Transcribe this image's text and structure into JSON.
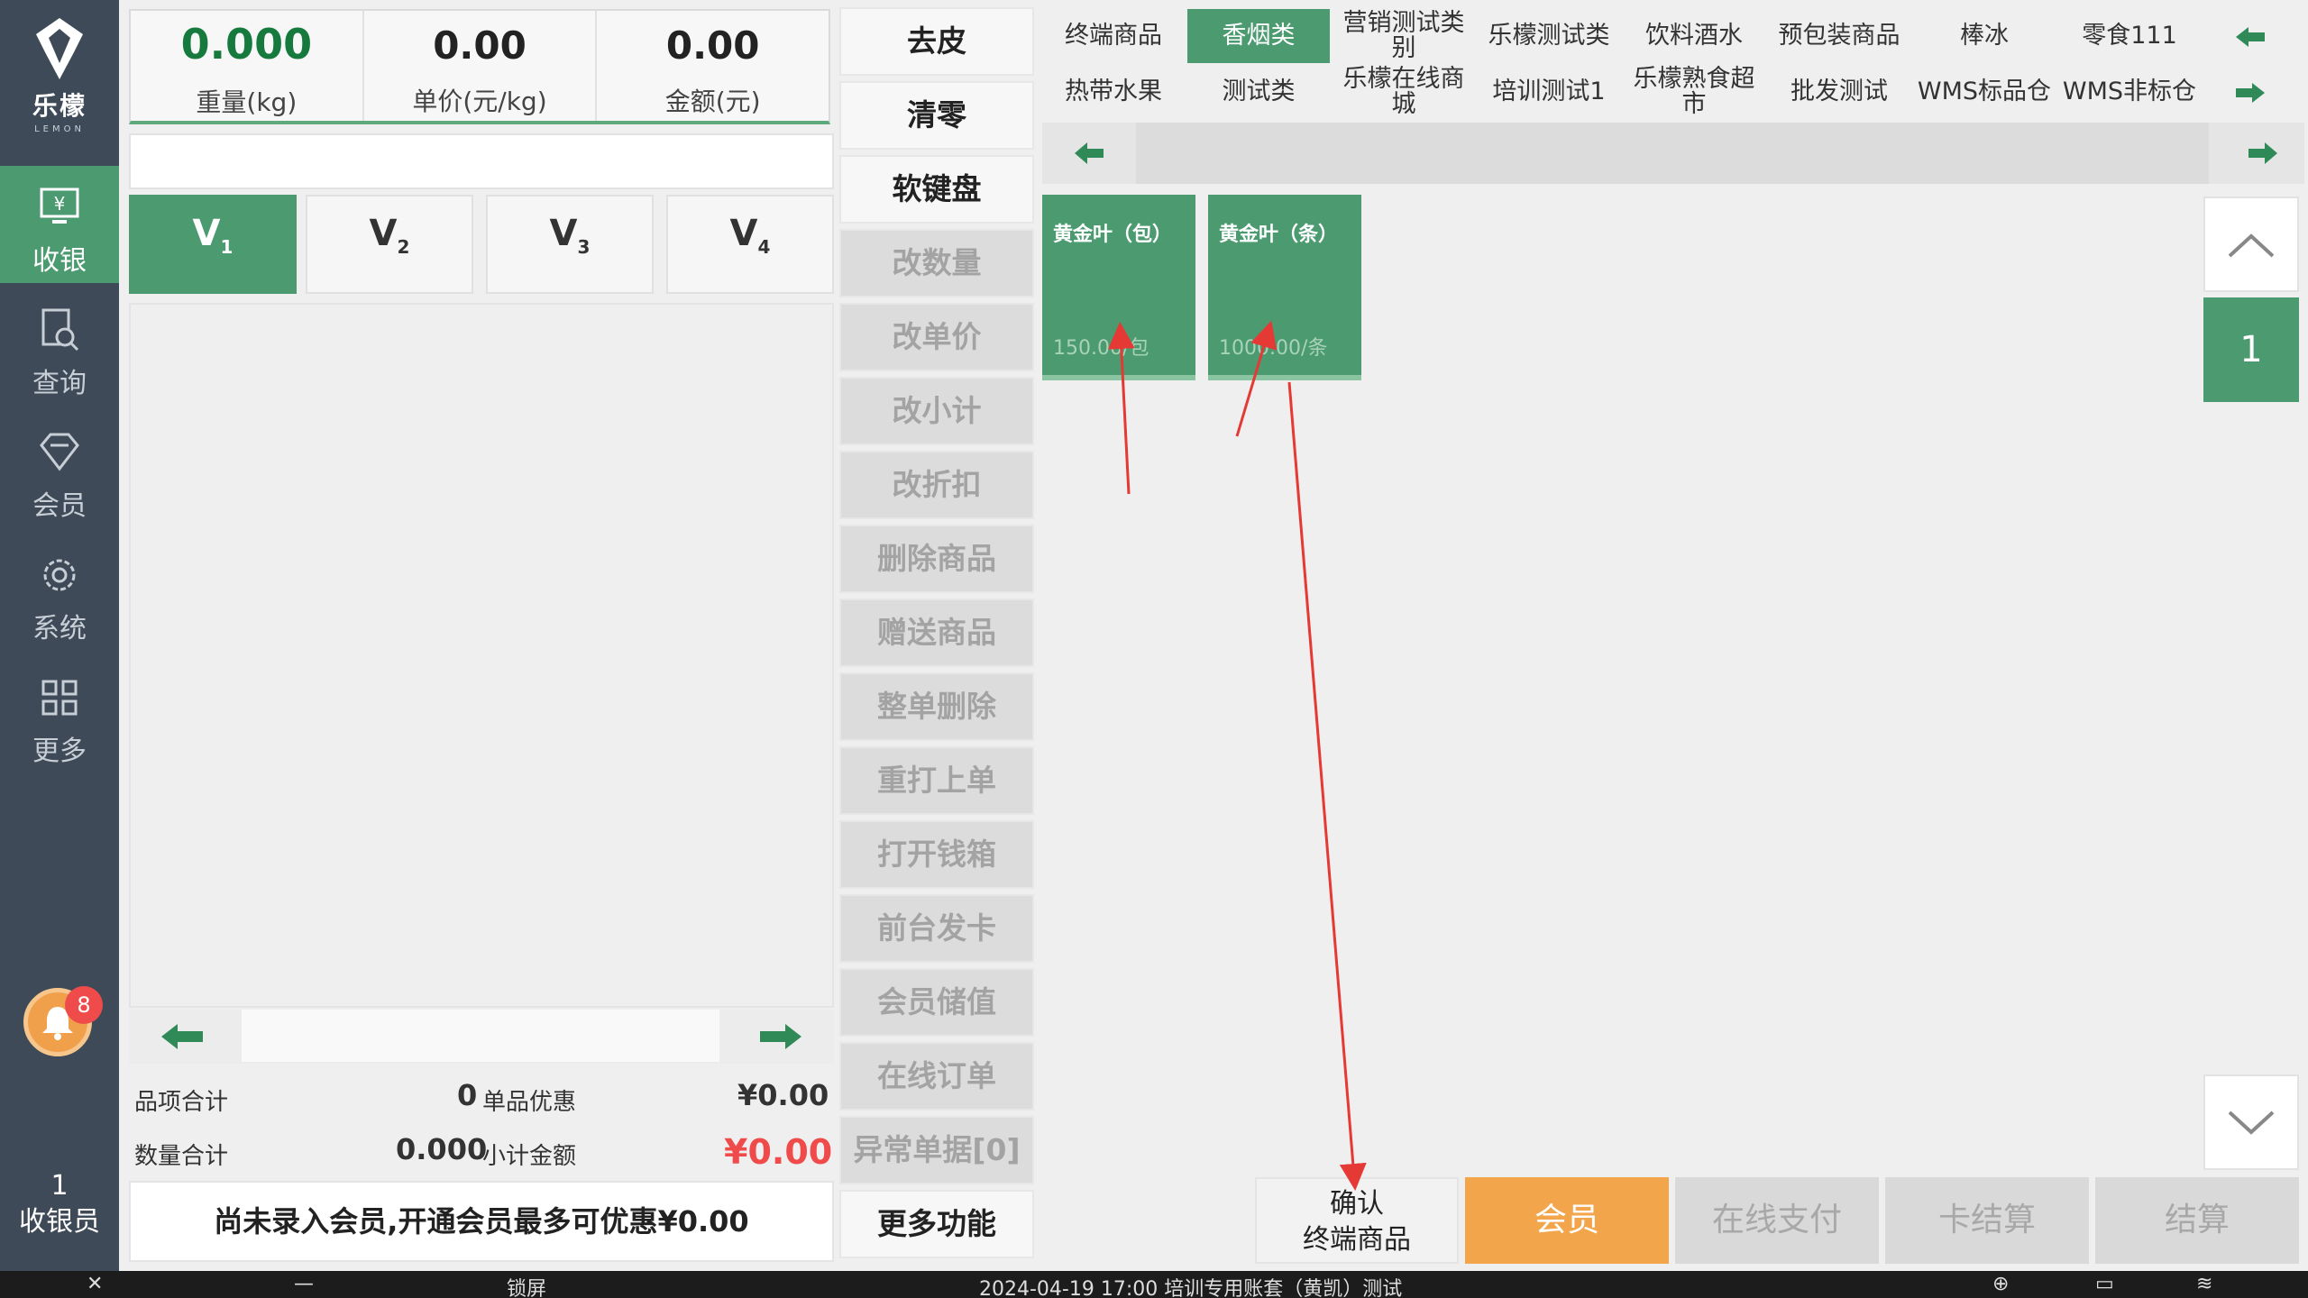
{
  "brand": {
    "name": "乐檬",
    "sub": "LEMON"
  },
  "nav": [
    {
      "label": "收银",
      "icon": "cashier-icon",
      "active": true
    },
    {
      "label": "查询",
      "icon": "query-icon",
      "active": false
    },
    {
      "label": "会员",
      "icon": "member-icon",
      "active": false
    },
    {
      "label": "系统",
      "icon": "settings-gear-icon",
      "active": false
    },
    {
      "label": "更多",
      "icon": "more-grid-icon",
      "active": false
    }
  ],
  "notifications": {
    "count": "8"
  },
  "cashier": {
    "id": "1",
    "label": "收银员"
  },
  "scale": {
    "weight_value": "0.000",
    "weight_label": "重量(kg)",
    "unit_price_value": "0.00",
    "unit_price_label": "单价(元/kg)",
    "amount_value": "0.00",
    "amount_label": "金额(元)"
  },
  "barcode_input": {
    "value": "",
    "placeholder": ""
  },
  "order_tabs": [
    {
      "label": "V",
      "sub": "1"
    },
    {
      "label": "V",
      "sub": "2"
    },
    {
      "label": "V",
      "sub": "3"
    },
    {
      "label": "V",
      "sub": "4"
    }
  ],
  "totals": {
    "item_count_label": "品项合计",
    "item_count": "0",
    "item_discount_label": "单品优惠",
    "item_discount": "¥0.00",
    "qty_label": "数量合计",
    "qty": "0.000",
    "subtotal_label": "小计金额",
    "subtotal": "¥0.00"
  },
  "promo_text": "尚未录入会员,开通会员最多可优惠¥0.00",
  "functions": [
    {
      "label": "去皮",
      "enabled": true
    },
    {
      "label": "清零",
      "enabled": true
    },
    {
      "label": "软键盘",
      "enabled": true
    },
    {
      "label": "改数量",
      "enabled": false
    },
    {
      "label": "改单价",
      "enabled": false
    },
    {
      "label": "改小计",
      "enabled": false
    },
    {
      "label": "改折扣",
      "enabled": false
    },
    {
      "label": "删除商品",
      "enabled": false
    },
    {
      "label": "赠送商品",
      "enabled": false
    },
    {
      "label": "整单删除",
      "enabled": false
    },
    {
      "label": "重打上单",
      "enabled": false
    },
    {
      "label": "打开钱箱",
      "enabled": false
    },
    {
      "label": "前台发卡",
      "enabled": false
    },
    {
      "label": "会员储值",
      "enabled": false
    },
    {
      "label": "在线订单",
      "enabled": false
    },
    {
      "label": "异常单据[0]",
      "enabled": false
    },
    {
      "label": "更多功能",
      "enabled": true
    }
  ],
  "categories_row1": [
    "终端商品",
    "香烟类",
    "营销测试类别",
    "乐檬测试类",
    "饮料酒水",
    "预包装商品",
    "棒冰",
    "零食111"
  ],
  "categories_row2": [
    "热带水果",
    "测试类",
    "乐檬在线商城",
    "培训测试1",
    "乐檬熟食超市",
    "批发测试",
    "WMS标品仓",
    "WMS非标仓"
  ],
  "active_category": "香烟类",
  "products": [
    {
      "name": "黄金叶（包）",
      "price": "150.00/包"
    },
    {
      "name": "黄金叶（条）",
      "price": "1000.00/条"
    }
  ],
  "pager": {
    "page": "1"
  },
  "confirm_button": {
    "line1": "确认",
    "line2": "终端商品"
  },
  "actions": [
    {
      "label": "会员",
      "enabled": true
    },
    {
      "label": "在线支付",
      "enabled": false
    },
    {
      "label": "卡结算",
      "enabled": false
    },
    {
      "label": "结算",
      "enabled": false
    }
  ],
  "statusbar": {
    "lock": "锁屏",
    "info": "2024-04-19 17:00 培训专用账套（黄凯）测试"
  },
  "colors": {
    "primary": "#4b9a70",
    "sidebar": "#3e4a57",
    "accent": "#f2a54a",
    "alert": "#ef4b4b"
  }
}
